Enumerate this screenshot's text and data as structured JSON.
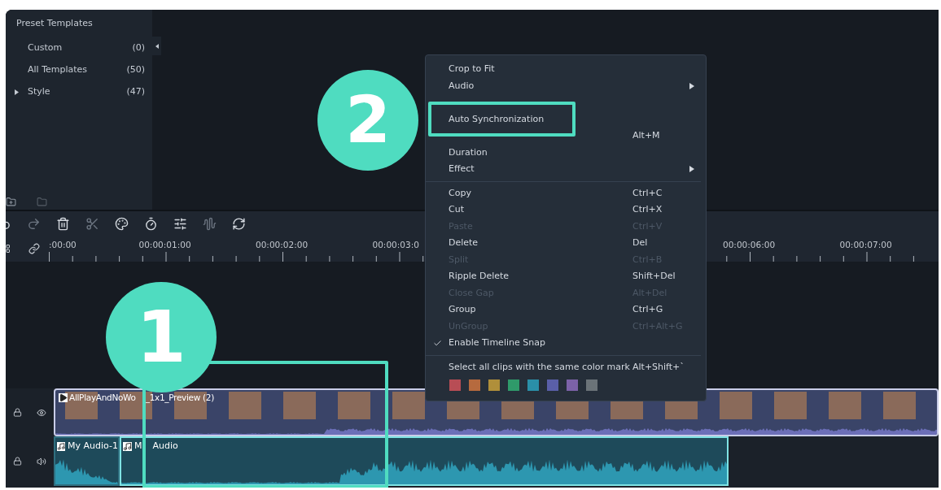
{
  "sidebar": {
    "title": "Preset Templates",
    "items": [
      {
        "label": "Custom",
        "count": "(0)",
        "expandable": false
      },
      {
        "label": "All Templates",
        "count": "(50)",
        "expandable": false
      },
      {
        "label": "Style",
        "count": "(47)",
        "expandable": true
      }
    ]
  },
  "toolbar": [
    {
      "kind": "undo",
      "disabled": false
    },
    {
      "kind": "redo",
      "disabled": true
    },
    {
      "kind": "delete",
      "disabled": false
    },
    {
      "kind": "cut",
      "disabled": true
    },
    {
      "kind": "color",
      "disabled": false
    },
    {
      "kind": "speed",
      "disabled": false
    },
    {
      "kind": "adjust",
      "disabled": false
    },
    {
      "kind": "audio",
      "disabled": true
    },
    {
      "kind": "sync",
      "disabled": false
    }
  ],
  "ruler": [
    ":00:00",
    "00:00:01:00",
    "00:00:02:00",
    "00:00:03:0",
    "00:00:06:00",
    "00:00:07:00"
  ],
  "tracks": [
    {
      "kind": "video",
      "clips": [
        {
          "title_parts": [
            "AllPlayAndNoWo",
            "_1x1_Preview (2)"
          ]
        }
      ]
    },
    {
      "kind": "audio",
      "clips": [
        {
          "title_parts": [
            "My Audio-1"
          ]
        },
        {
          "title_parts": [
            "M",
            "Audio"
          ]
        }
      ]
    }
  ],
  "context_menu": [
    {
      "kind": "item",
      "label": "Crop to Fit",
      "disabled": false,
      "submenu": false,
      "checked": false
    },
    {
      "kind": "item",
      "label": "Audio",
      "disabled": false,
      "submenu": true,
      "checked": false
    },
    {
      "kind": "obscured"
    },
    {
      "kind": "item",
      "label": "Auto Synchronization",
      "disabled": false,
      "submenu": false,
      "checked": false
    },
    {
      "kind": "item",
      "shortcut": "Alt+M",
      "disabled": false,
      "submenu": false,
      "checked": false
    },
    {
      "kind": "item",
      "label": "Duration",
      "disabled": false,
      "submenu": false,
      "checked": false
    },
    {
      "kind": "item",
      "label": "Effect",
      "disabled": false,
      "submenu": true,
      "checked": false
    },
    {
      "kind": "separator"
    },
    {
      "kind": "item",
      "label": "Copy",
      "shortcut": "Ctrl+C",
      "disabled": false,
      "submenu": false,
      "checked": false
    },
    {
      "kind": "item",
      "label": "Cut",
      "shortcut": "Ctrl+X",
      "disabled": false,
      "submenu": false,
      "checked": false
    },
    {
      "kind": "item",
      "label": "Paste",
      "shortcut": "Ctrl+V",
      "disabled": true,
      "submenu": false,
      "checked": false
    },
    {
      "kind": "item",
      "label": "Delete",
      "shortcut": "Del",
      "disabled": false,
      "submenu": false,
      "checked": false
    },
    {
      "kind": "item",
      "label": "Split",
      "shortcut": "Ctrl+B",
      "disabled": true,
      "submenu": false,
      "checked": false
    },
    {
      "kind": "item",
      "label": "Ripple Delete",
      "shortcut": "Shift+Del",
      "disabled": false,
      "submenu": false,
      "checked": false
    },
    {
      "kind": "item",
      "label": "Close Gap",
      "shortcut": "Alt+Del",
      "disabled": true,
      "submenu": false,
      "checked": false
    },
    {
      "kind": "item",
      "label": "Group",
      "shortcut": "Ctrl+G",
      "disabled": false,
      "submenu": false,
      "checked": false
    },
    {
      "kind": "item",
      "label": "UnGroup",
      "shortcut": "Ctrl+Alt+G",
      "disabled": true,
      "submenu": false,
      "checked": false
    },
    {
      "kind": "item",
      "label": "Enable Timeline Snap",
      "disabled": false,
      "submenu": false,
      "checked": true
    },
    {
      "kind": "separator"
    },
    {
      "kind": "item",
      "label": "Select all clips with the same color mark",
      "shortcut": "Alt+Shift+`",
      "disabled": false,
      "submenu": false,
      "checked": false
    },
    {
      "kind": "swatches",
      "colors": [
        {
          "color": "#b84d55"
        },
        {
          "color": "#b66a3e"
        },
        {
          "color": "#b08f3a"
        },
        {
          "color": "#2f9a6a"
        },
        {
          "color": "#2a8fa8"
        },
        {
          "color": "#5a5fa8"
        },
        {
          "color": "#7c62a8"
        },
        {
          "color": "#6b7378"
        }
      ]
    }
  ],
  "callouts": [
    {
      "label": "1"
    },
    {
      "label": "2"
    }
  ]
}
